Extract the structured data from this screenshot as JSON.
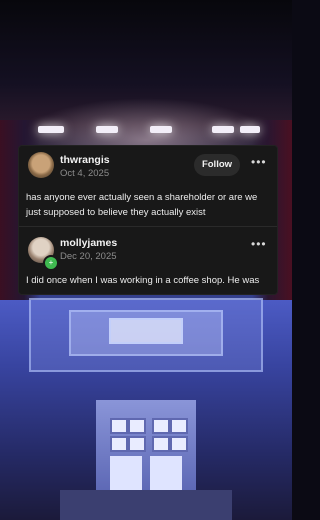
{
  "thread": {
    "post": {
      "username": "thwrangis",
      "date": "Oct 4, 2025",
      "follow_label": "Follow",
      "more_icon": "more-horizontal-icon",
      "text": "has anyone ever actually seen a shareholder or are we just supposed to believe they actually exist"
    },
    "reply": {
      "username": "mollyjames",
      "date": "Dec 20, 2025",
      "badge_icon": "plus-badge-icon",
      "badge_color": "#3fb950",
      "more_icon": "more-horizontal-icon",
      "text": "I did once when I was working in a coffee shop. He was"
    }
  },
  "colors": {
    "card_bg": "#181818",
    "text": "#ececec",
    "muted": "#8c8c8c"
  }
}
